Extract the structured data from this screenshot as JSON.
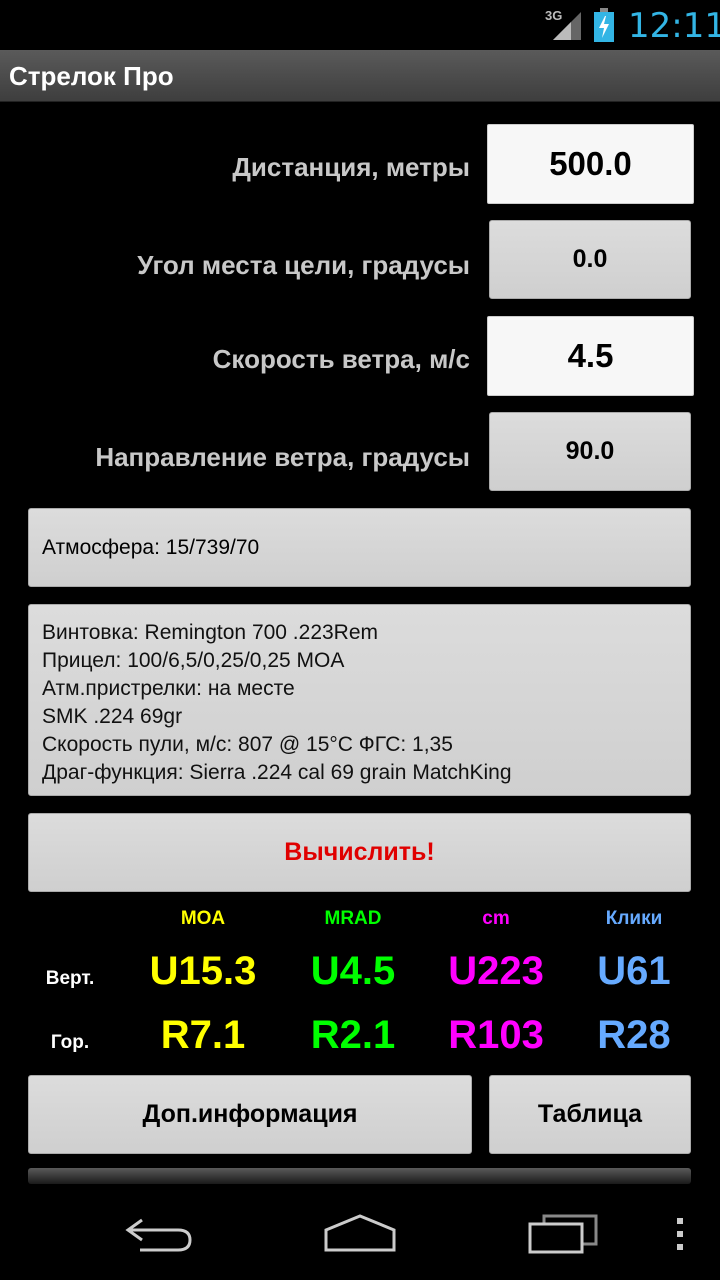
{
  "status": {
    "network": "3G",
    "time": "12:11"
  },
  "app": {
    "title": "Стрелок Про"
  },
  "inputs": {
    "distance": {
      "label": "Дистанция, метры",
      "value": "500.0"
    },
    "angle": {
      "label": "Угол места цели, градусы",
      "value": "0.0"
    },
    "wind_speed": {
      "label": "Скорость ветра, м/с",
      "value": "4.5"
    },
    "wind_direction": {
      "label": "Направление ветра, градусы",
      "value": "90.0"
    }
  },
  "atmosphere": {
    "label": "Атмосфера: 15/739/70"
  },
  "rifle_info": {
    "lines": [
      "Винтовка: Remington 700 .223Rem",
      "Прицел: 100/6,5/0,25/0,25 MOA",
      "Атм.пристрелки: на месте",
      "SMK .224 69gr",
      "Скорость пули, м/с: 807 @ 15°C ФГС: 1,35",
      "Драг-функция: Sierra .224 cal 69 grain MatchKing"
    ]
  },
  "calculate": {
    "label": "Вычислить!"
  },
  "results": {
    "columns": [
      "MOA",
      "MRAD",
      "cm",
      "Клики"
    ],
    "rows": [
      {
        "label": "Верт.",
        "values": [
          "U15.3",
          "U4.5",
          "U223",
          "U61"
        ]
      },
      {
        "label": "Гор.",
        "values": [
          "R7.1",
          "R2.1",
          "R103",
          "R28"
        ]
      }
    ],
    "colors": [
      "#ffff00",
      "#00ff00",
      "#ff00ff",
      "#66aaff"
    ]
  },
  "buttons": {
    "more_info": "Доп.информация",
    "table": "Таблица"
  },
  "nav": {
    "icons": [
      "back-icon",
      "home-icon",
      "recent-apps-icon",
      "overflow-menu-icon"
    ]
  }
}
